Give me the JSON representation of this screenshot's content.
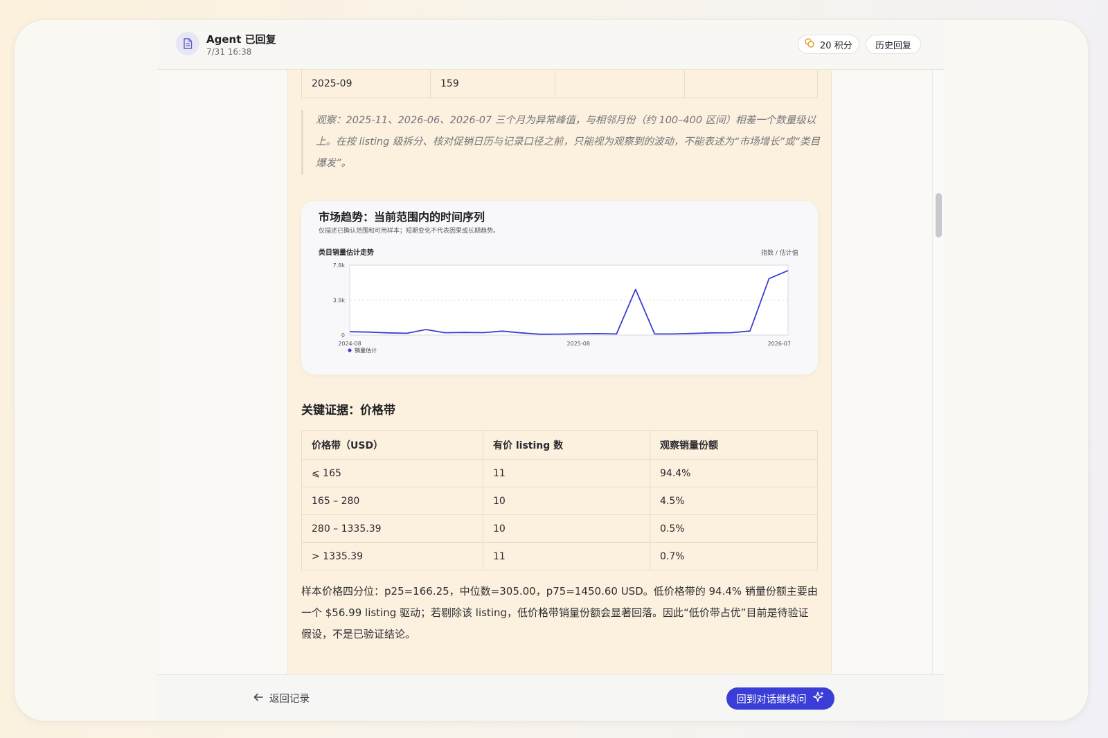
{
  "header": {
    "title": "Agent 已回复",
    "timestamp": "7/31 16:38",
    "points_label": "20 积分",
    "history_label": "历史回复",
    "icons": {
      "doc": "document-icon",
      "points": "coins-icon"
    }
  },
  "top_table": {
    "rows": [
      [
        "2025-09",
        "159",
        "",
        ""
      ]
    ]
  },
  "observation": "观察：2025-11、2026-06、2026-07 三个月为异常峰值，与相邻月份（约 100–400 区间）相差一个数量级以上。在按 listing 级拆分、核对促销日历与记录口径之前，只能视为观察到的波动，不能表述为“市场增长”或“类目爆发”。",
  "chart_card": {
    "title": "市场趋势：当前范围内的时间序列",
    "subtitle": "仅描述已确认范围和可用样本；短期变化不代表因果或长期趋势。",
    "chart_label": "类目销量估计走势",
    "unit_label": "指数 / 估计值"
  },
  "chart_data": {
    "type": "line",
    "x": [
      "2024-08",
      "2024-09",
      "2024-10",
      "2024-11",
      "2024-12",
      "2025-01",
      "2025-02",
      "2025-03",
      "2025-04",
      "2025-05",
      "2025-06",
      "2025-07",
      "2025-08",
      "2025-09",
      "2025-10",
      "2025-11",
      "2025-12",
      "2026-01",
      "2026-02",
      "2026-03",
      "2026-04",
      "2026-05",
      "2026-06",
      "2026-07"
    ],
    "xticks": [
      "2024-08",
      "2025-08",
      "2026-07"
    ],
    "yticks": [
      {
        "value": 0,
        "label": "0"
      },
      {
        "value": 3900,
        "label": "3.9k"
      },
      {
        "value": 7800,
        "label": "7.8k"
      }
    ],
    "ylim": [
      0,
      7800
    ],
    "series": [
      {
        "name": "销量估计",
        "color": "#3a3fcf",
        "values": [
          380,
          330,
          250,
          200,
          620,
          260,
          290,
          270,
          440,
          250,
          90,
          110,
          140,
          159,
          120,
          5100,
          120,
          120,
          180,
          250,
          260,
          450,
          6300,
          7200
        ]
      }
    ],
    "grid": true,
    "legend": "bottom-left"
  },
  "price_section": {
    "title": "关键证据：价格带",
    "headers": [
      "价格带（USD）",
      "有价 listing 数",
      "观察销量份额"
    ],
    "rows": [
      [
        "⩽ 165",
        "11",
        "94.4%"
      ],
      [
        "165 – 280",
        "10",
        "4.5%"
      ],
      [
        "280 – 1335.39",
        "10",
        "0.5%"
      ],
      [
        "> 1335.39",
        "11",
        "0.7%"
      ]
    ]
  },
  "summary": "样本价格四分位：p25=166.25，中位数=305.00，p75=1450.60 USD。低价格带的 94.4% 销量份额主要由一个 $56.99 listing 驱动；若剔除该 listing，低价格带销量份额会显著回落。因此“低价带占优”目前是待验证假设，不是已验证结论。",
  "footer": {
    "back_label": "返回记录",
    "continue_label": "回到对话继续问",
    "colors": {
      "accent": "#3a3ed6"
    }
  }
}
